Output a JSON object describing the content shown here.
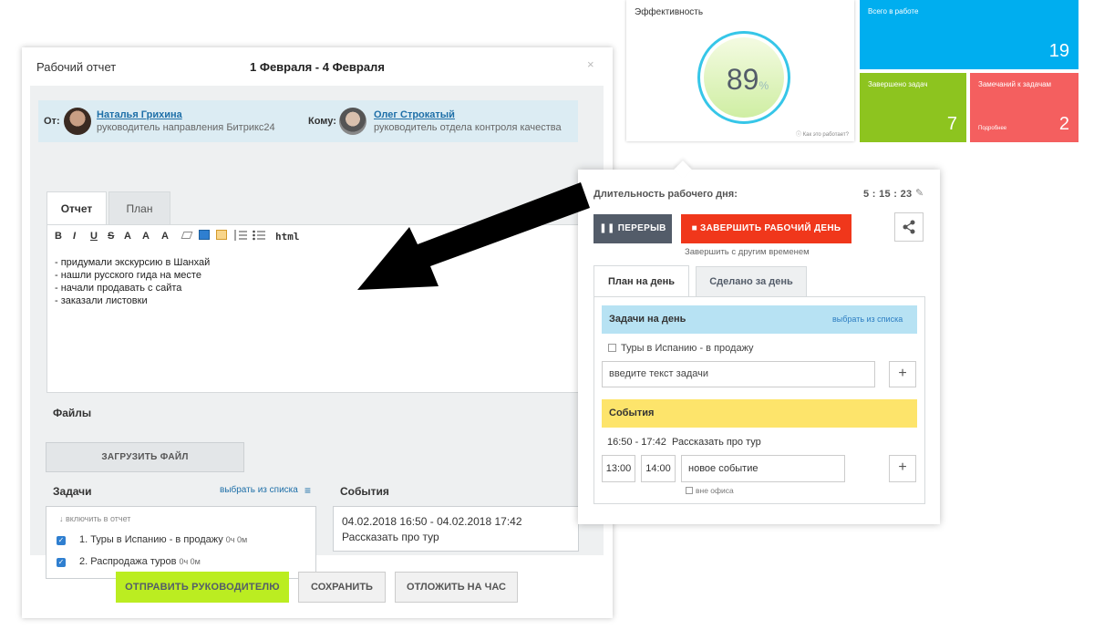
{
  "report": {
    "title": "Рабочий отчет",
    "period": "1 Февраля - 4 Февраля",
    "close": "×",
    "from_label": "От:",
    "from_name": "Наталья Грихина",
    "from_role": "руководитель направления Битрикс24",
    "to_label": "Кому:",
    "to_name": "Олег Строкатый",
    "to_role": "руководитель отдела контроля качества",
    "tabs": [
      "Отчет",
      "План"
    ],
    "toolbar": [
      "B",
      "I",
      "U",
      "S",
      "A",
      "A",
      "A",
      "html"
    ],
    "editor_lines": [
      "- придумали экскурсию в Шанхай",
      "- нашли русского гида на месте",
      "- начали продавать с сайта",
      "- заказали листовки"
    ],
    "files_label": "Файлы",
    "upload_label": "ЗАГРУЗИТЬ ФАЙЛ",
    "tasks_label": "Задачи",
    "tasks_link": "выбрать из списка",
    "include_label": "включить в отчет",
    "tasks": [
      {
        "text": "1. Туры в Испанию - в продажу",
        "hours": "0ч 0м"
      },
      {
        "text": "2. Распродажа туров",
        "hours": "0ч 0м"
      }
    ],
    "events_label": "События",
    "event_time": "04.02.2018 16:50 - 04.02.2018 17:42",
    "event_text": "Рассказать про тур",
    "send_label": "ОТПРАВИТЬ РУКОВОДИТЕЛЮ",
    "save_label": "СОХРАНИТЬ",
    "later_label": "ОТЛОЖИТЬ НА ЧАС"
  },
  "efficiency": {
    "title": "Эффективность",
    "value": "89",
    "unit": "%",
    "how_link": "Как это работает?"
  },
  "tiles": {
    "total_title": "Всего в работе",
    "total_value": "19",
    "done_title": "Завершено задач",
    "done_value": "7",
    "remarks_title": "Замечаний к задачам",
    "remarks_sub": "Подробнее",
    "remarks_value": "2",
    "colors": {
      "total": "#00aeef",
      "done": "#8dc41f",
      "remarks": "#f45f5f"
    }
  },
  "workday": {
    "duration_label": "Длительность рабочего дня:",
    "time": "5 : 15 : 23",
    "pause_label": "ПЕРЕРЫВ",
    "finish_label": "ЗАВЕРШИТЬ РАБОЧИЙ ДЕНЬ",
    "finish_other": "Завершить с другим временем",
    "tabs": [
      "План на день",
      "Сделано за день"
    ],
    "tasks_head": "Задачи на день",
    "tasks_link": "выбрать из списка",
    "task": "Туры в Испанию - в продажу",
    "task_placeholder": "введите текст задачи",
    "events_head": "События",
    "event_time": "16:50 - 17:42",
    "event_text": "Рассказать про тур",
    "from": "13:00",
    "to": "14:00",
    "new_event": "новое событие",
    "out_of_office": "вне офиса"
  }
}
